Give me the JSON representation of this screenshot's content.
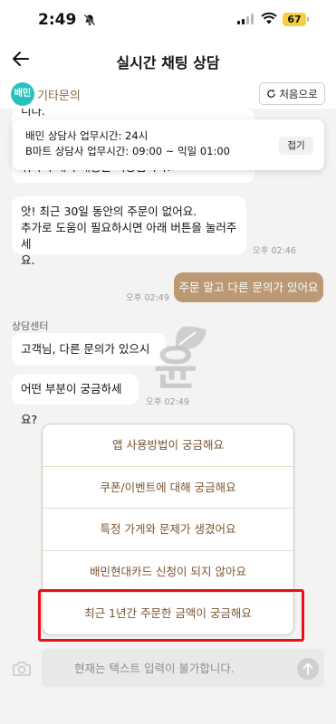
{
  "status_bar": {
    "time": "2:49",
    "battery": "67",
    "icons": [
      "bell-slash-icon",
      "signal-icon",
      "wifi-icon",
      "battery-icon"
    ]
  },
  "header": {
    "title": "실시간 채팅 상담",
    "back_icon": "arrow-left-icon"
  },
  "category": {
    "logo": "배민",
    "label": "기타문의",
    "restart_label": "처음으로",
    "restart_icon": "refresh-icon"
  },
  "notice": {
    "line1": "배민 상담사 업무시간: 24시",
    "line2": "B마트 상담사 업무시간: 09:00 ~ 익일 01:00",
    "collapse_label": "접기"
  },
  "messages": {
    "partial_top_line1": "니다.",
    "partial_top_line2": "위하여 대화 내용은 저장됩니다.",
    "no_order_line1": "앗! 최근 30일 동안의 주문이 없어요.",
    "no_order_line2": "추가로 도움이 필요하시면 아래 버튼을 눌러주세",
    "no_order_line3": "요.",
    "no_order_time": "오후 02:46",
    "mine_text": "주문 말고 다른 문의가 있어요",
    "mine_time": "오후 02:49",
    "sender": "상담센터",
    "greet_text": "고객님, 다른 문의가 있으시군요.",
    "ask_text": "어떤 부분이 궁금하세요?",
    "ask_time": "오후 02:49"
  },
  "watermark_text": "윤",
  "options": [
    "앱 사용방법이 궁금해요",
    "쿠폰/이벤트에 대해 궁금해요",
    "특정 가게와 문제가 생겼어요",
    "배민현대카드 신청이 되지 않아요",
    "최근 1년간 주문한 금액이 궁금해요"
  ],
  "input": {
    "placeholder": "현재는 텍스트 입력이 불가합니다.",
    "camera_icon": "camera-icon",
    "send_icon": "arrow-up-icon"
  },
  "colors": {
    "brand_teal": "#2ac1bc",
    "accent_brown": "#bb9975",
    "option_text": "#7a5530",
    "highlight_red": "#e8101a"
  }
}
